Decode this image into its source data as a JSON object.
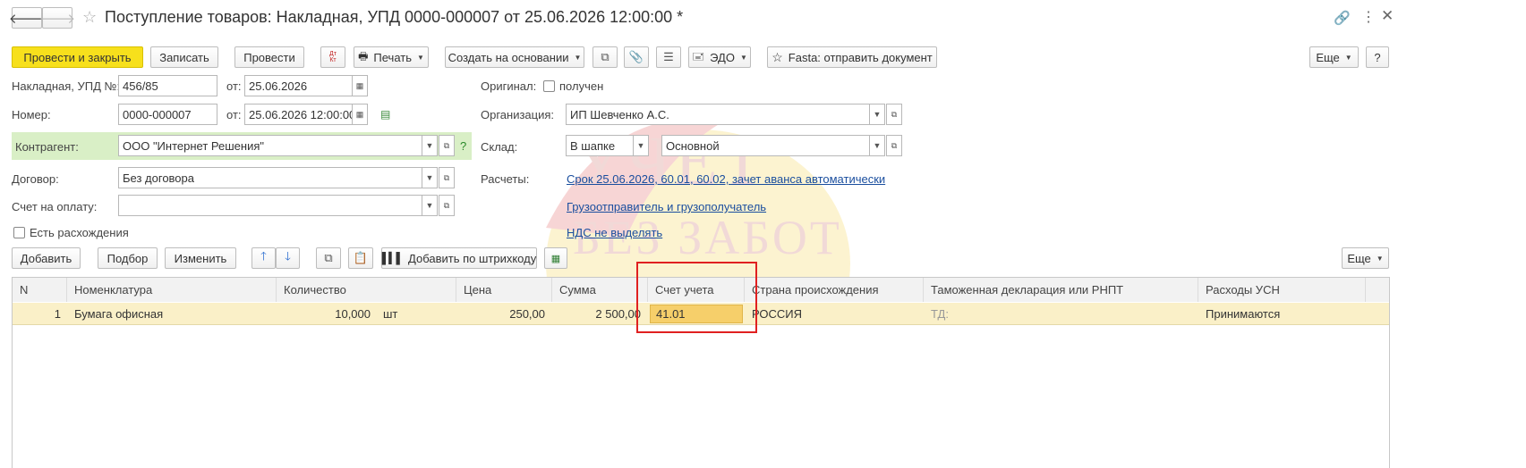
{
  "window": {
    "title": "Поступление товаров: Накладная, УПД 0000-000007 от 25.06.2026 12:00:00 *",
    "back_icon": "arrow-left-icon",
    "forward_icon": "arrow-right-icon",
    "star_icon": "star-icon",
    "link_icon": "link-icon",
    "menu_icon": "more-vertical-icon",
    "close_icon": "close-icon"
  },
  "toolbar": {
    "post_close": "Провести и закрыть",
    "save": "Записать",
    "post": "Провести",
    "dtkt": "Дт Кт",
    "print": "Печать",
    "create_based": "Создать на основании",
    "edo": "ЭДО",
    "fasta": "Fasta: отправить документ",
    "more": "Еще",
    "help": "?"
  },
  "header": {
    "invoice_label": "Накладная, УПД №:",
    "invoice_value": "456/85",
    "from1_label": "от:",
    "from1_value": "25.06.2026",
    "number_label": "Номер:",
    "number_value": "0000-000007",
    "from2_label": "от:",
    "from2_value": "25.06.2026 12:00:00",
    "counterparty_label": "Контрагент:",
    "counterparty_value": "ООО \"Интернет Решения\"",
    "contract_label": "Договор:",
    "contract_value": "Без договора",
    "payment_label": "Счет на оплату:",
    "payment_value": "",
    "discrepancy_label": "Есть расхождения",
    "original_label": "Оригинал:",
    "original_check_label": "получен",
    "org_label": "Организация:",
    "org_value": "ИП Шевченко А.С.",
    "warehouse_label": "Склад:",
    "warehouse_mode": "В шапке",
    "warehouse_value": "Основной",
    "settlements_label": "Расчеты:",
    "settlements_link": "Срок 25.06.2026, 60.01, 60.02, зачет аванса автоматически",
    "shipper_link": "Грузоотправитель и грузополучатель",
    "vat_link": "НДС не выделять"
  },
  "table_toolbar": {
    "add": "Добавить",
    "pick": "Подбор",
    "change": "Изменить",
    "barcode": "Добавить по штрихкоду",
    "more": "Еще"
  },
  "table": {
    "columns": [
      "N",
      "Номенклатура",
      "Количество",
      "Цена",
      "Сумма",
      "Счет учета",
      "Страна происхождения",
      "Таможенная декларация или РНПТ",
      "Расходы УСН"
    ],
    "rows": [
      {
        "n": "1",
        "item": "Бумага офисная",
        "qty": "10,000",
        "unit": "шт",
        "price": "250,00",
        "sum": "2 500,00",
        "account": "41.01",
        "country": "РОССИЯ",
        "customs": "ТД:",
        "usn": "Принимаются"
      }
    ]
  },
  "watermark": {
    "line1": "УЧЕТ",
    "line2": "БЕЗ ЗАБОТ"
  },
  "colors": {
    "primary_button": "#f7e01c",
    "counterparty_bg": "#d9efc6",
    "selected_row": "#faf0c8",
    "highlight_box": "#e02020",
    "link": "#1a4e9e"
  }
}
